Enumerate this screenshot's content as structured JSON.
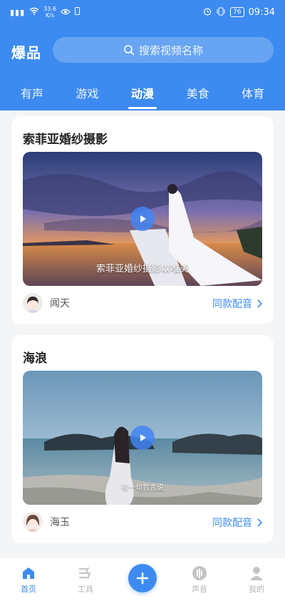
{
  "status_bar": {
    "signal": "ⁱˡˡ",
    "network_speed": "33.6",
    "network_unit": "K/s",
    "battery": "76",
    "time": "09:34"
  },
  "header": {
    "brand": "爆品",
    "search_placeholder": "搜索视频名称",
    "tabs": [
      {
        "label": "有声"
      },
      {
        "label": "游戏"
      },
      {
        "label": "动漫",
        "active": true
      },
      {
        "label": "美食"
      },
      {
        "label": "体育"
      }
    ]
  },
  "feed": [
    {
      "title": "索菲亚婚纱摄影",
      "caption": "索菲亚婚纱摄影以唯美",
      "author": "闻天",
      "dub_label": "同款配音"
    },
    {
      "title": "海浪",
      "caption": "有一句哲言说",
      "author": "海玉",
      "dub_label": "同款配音"
    }
  ],
  "bottom_nav": [
    {
      "label": "首页",
      "icon": "home-icon",
      "active": true
    },
    {
      "label": "工具",
      "icon": "tools-icon"
    },
    {
      "label": "",
      "icon": "plus-icon"
    },
    {
      "label": "声音",
      "icon": "sound-icon"
    },
    {
      "label": "我的",
      "icon": "user-icon"
    }
  ],
  "colors": {
    "primary": "#3d8bf0",
    "background": "#f4f5f7",
    "inactive": "#b5b5b5"
  }
}
